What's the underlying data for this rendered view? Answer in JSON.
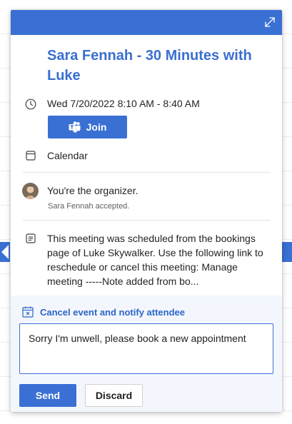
{
  "event": {
    "title": "Sara Fennah - 30 Minutes with Luke",
    "datetime": "Wed 7/20/2022 8:10 AM - 8:40 AM",
    "join_label": "Join",
    "calendar_label": "Calendar",
    "organizer_text": "You're the organizer.",
    "attendee_status": "Sara Fennah accepted.",
    "notes": "This meeting was scheduled from the bookings page of Luke Skywalker. Use the following link to reschedule or cancel this meeting: Manage meeting -----Note added from bo..."
  },
  "cancel": {
    "label": "Cancel event and notify attendee",
    "message": "Sorry I'm unwell, please book a new appointment",
    "send_label": "Send",
    "discard_label": "Discard"
  },
  "icons": {
    "expand": "expand-icon",
    "clock": "clock-icon",
    "teams": "teams-icon",
    "calendar": "calendar-icon",
    "notes": "notes-icon",
    "cancel_calendar": "calendar-cancel-icon"
  },
  "colors": {
    "accent": "#3a70d4",
    "title": "#3a6fd0",
    "panel_bg": "#f3f7fd"
  }
}
